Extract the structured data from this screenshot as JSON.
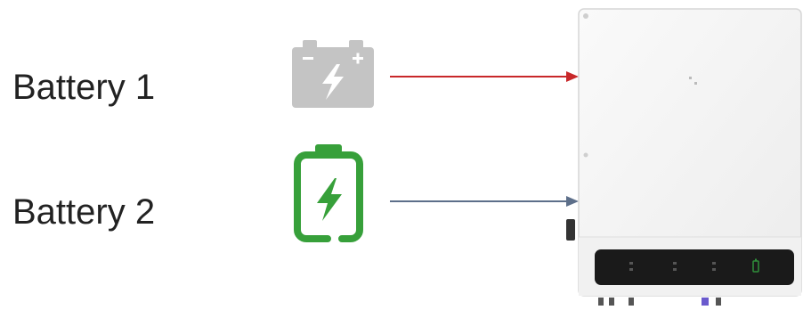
{
  "battery_1": {
    "label": "Battery 1",
    "icon": "battery-inactive-icon",
    "color": "#c4c4c4",
    "arrow_color": "#c8282a"
  },
  "battery_2": {
    "label": "Battery 2",
    "icon": "battery-charging-icon",
    "color": "#37a03a",
    "arrow_color": "#5d6f8a"
  },
  "inverter": {
    "icon": "inverter-icon",
    "panel_color": "#1a1a1a",
    "indicator_color": "#2f8f3b"
  }
}
